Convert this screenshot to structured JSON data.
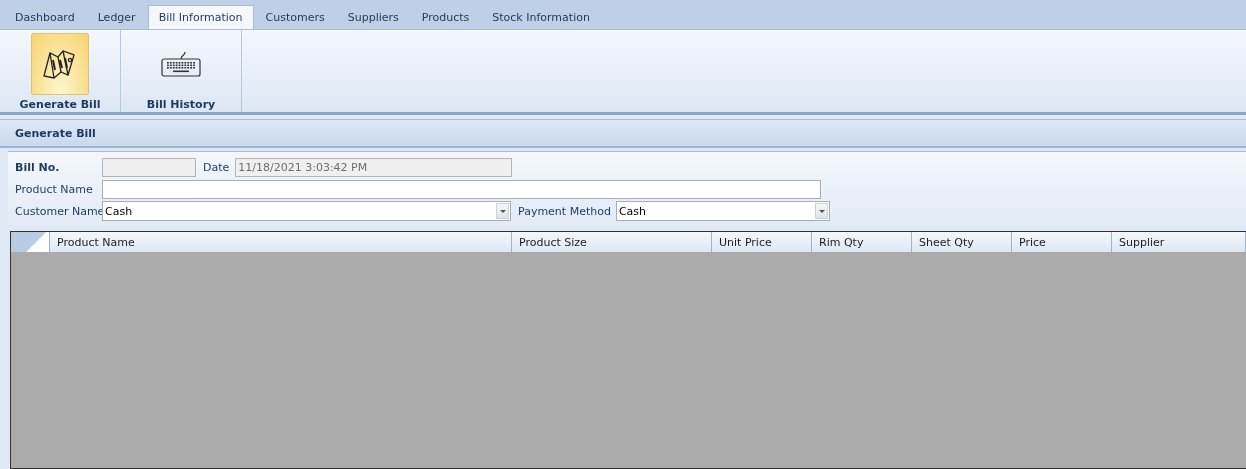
{
  "tabs": [
    {
      "label": "Dashboard",
      "selected": false
    },
    {
      "label": "Ledger",
      "selected": false
    },
    {
      "label": "Bill Information",
      "selected": true
    },
    {
      "label": "Customers",
      "selected": false
    },
    {
      "label": "Suppliers",
      "selected": false
    },
    {
      "label": "Products",
      "selected": false
    },
    {
      "label": "Stock Information",
      "selected": false
    }
  ],
  "ribbon": [
    {
      "label": "Generate Bill",
      "kind": "map",
      "selected": true
    },
    {
      "label": "Bill History",
      "kind": "keyboard",
      "selected": false
    }
  ],
  "section_title": "Generate Bill",
  "form": {
    "bill_no": {
      "label": "Bill No.",
      "disabled": true
    },
    "date": {
      "label": "Date",
      "value": "11/18/2021 3:03:42 PM",
      "disabled": true
    },
    "product_name": {
      "label": "Product Name"
    },
    "customer_name": {
      "label": "Customer Name",
      "value": "Cash"
    },
    "payment_method": {
      "label": "Payment Method",
      "value": "Cash"
    }
  },
  "table": {
    "columns": [
      "Product Name",
      "Product Size",
      "Unit Price",
      "Rim Qty",
      "Sheet Qty",
      "Price",
      "Supplier"
    ]
  }
}
